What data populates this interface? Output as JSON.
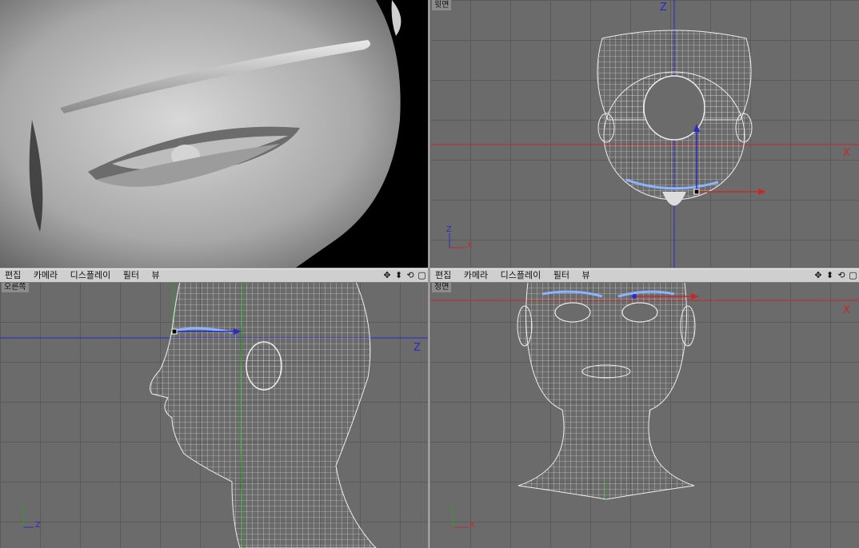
{
  "viewports": {
    "top": {
      "label": "윗면",
      "axis_h": "X",
      "axis_v": "Z",
      "gizmo_h": "X",
      "gizmo_v": "Z"
    },
    "right": {
      "label": "오른쪽",
      "axis_h": "Z",
      "gizmo_h": "Z",
      "gizmo_v": "Y"
    },
    "front": {
      "label": "정면",
      "axis_h": "X",
      "gizmo_h": "X",
      "gizmo_v": "Y"
    }
  },
  "menu_left": {
    "edit": "편집",
    "camera": "카메라",
    "display": "디스플레이",
    "filter": "필터",
    "view": "뷰"
  },
  "menu_right": {
    "edit": "편집",
    "camera": "카메라",
    "display": "디스플레이",
    "filter": "필터",
    "view": "뷰"
  },
  "tool_icons": [
    "move-icon",
    "zoom-icon",
    "rotate-icon",
    "maximize-icon"
  ],
  "colors": {
    "viewport_bg": "#6b6b6b",
    "grid": "#5a5a5a",
    "x_axis": "#c42a2a",
    "z_axis": "#2a2ac4",
    "y_axis": "#2aa02a",
    "wire": "#e8e8e8",
    "selection": "#8ab4ff"
  }
}
